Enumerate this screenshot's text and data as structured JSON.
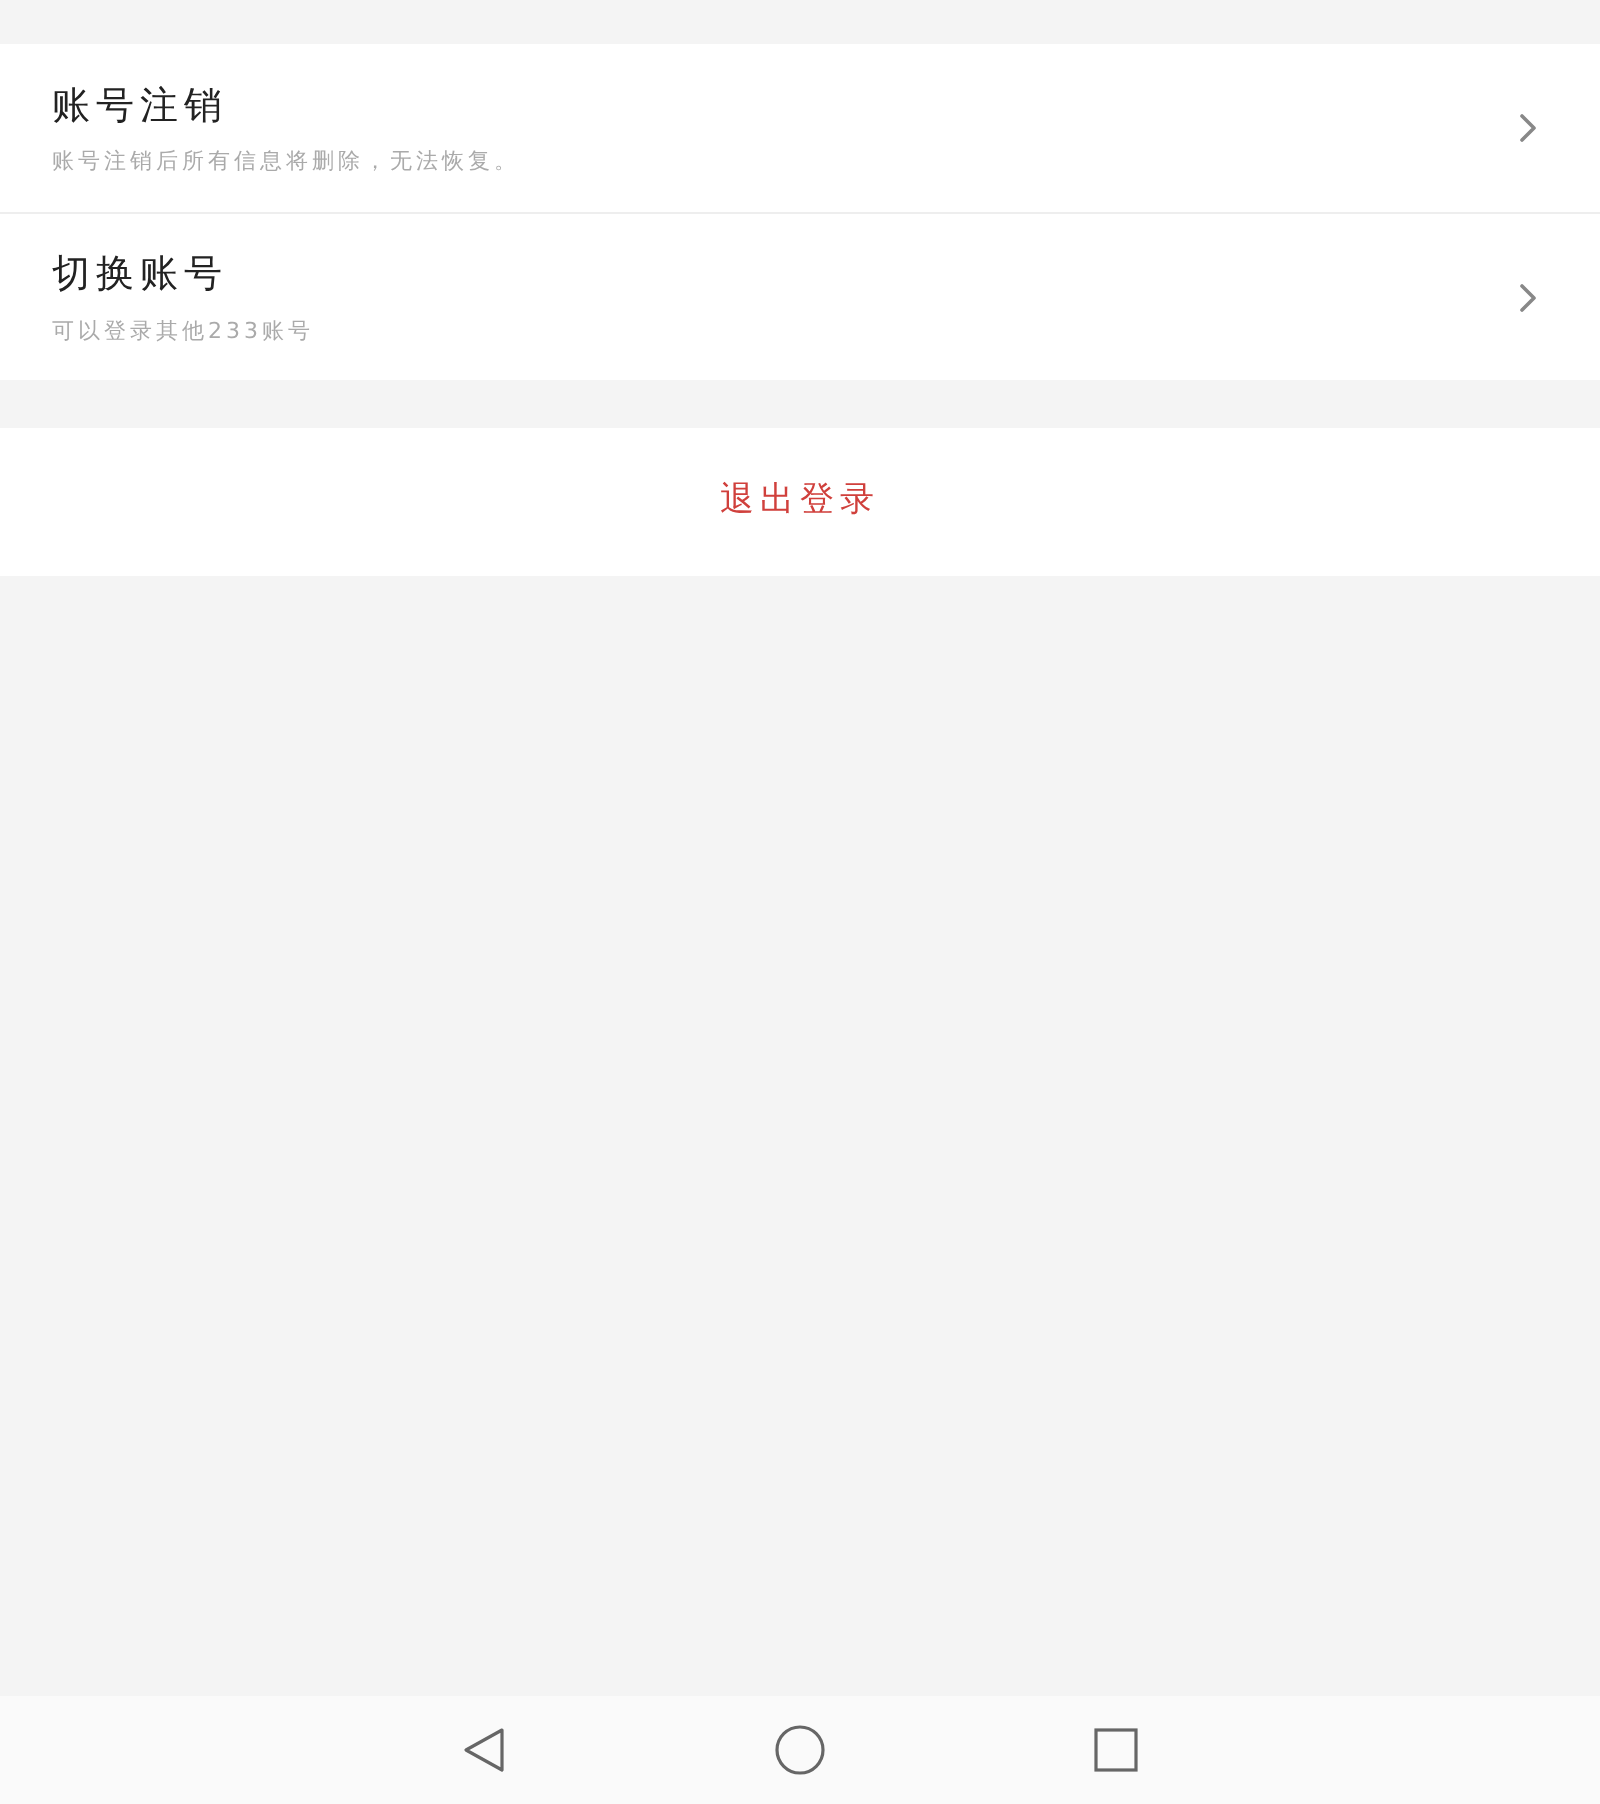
{
  "settings_items": [
    {
      "title": "账号注销",
      "subtitle": "账号注销后所有信息将删除，无法恢复。"
    },
    {
      "title": "切换账号",
      "subtitle": "可以登录其他233账号"
    }
  ],
  "logout_button": {
    "label": "退出登录"
  }
}
